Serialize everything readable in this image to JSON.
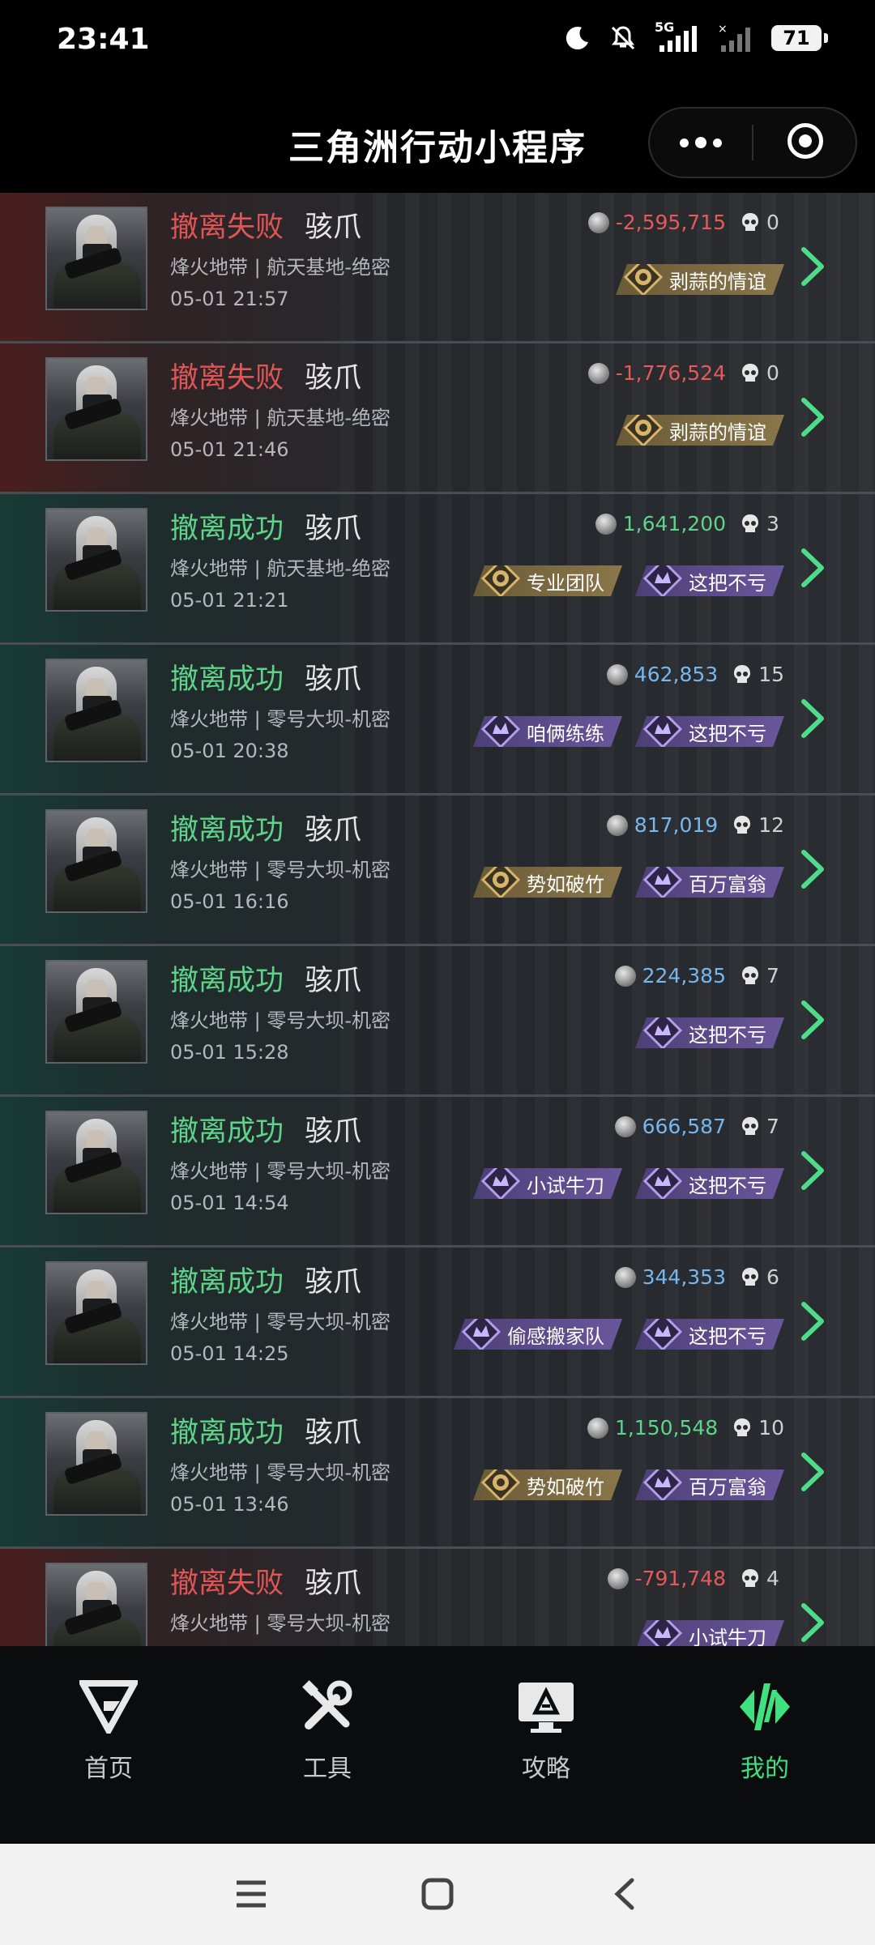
{
  "status_bar": {
    "time": "23:41",
    "network": "5G",
    "battery": "71"
  },
  "header": {
    "title": "三角洲行动小程序"
  },
  "records": [
    {
      "result": "撤离失败",
      "result_type": "fail",
      "operator": "骇爪",
      "map": "烽火地带 | 航天基地-绝密",
      "time": "05-01 21:57",
      "value": "-2,595,715",
      "value_type": "neg",
      "kills": "0",
      "badges": [
        {
          "label": "剥蒜的情谊",
          "style": "gold"
        }
      ]
    },
    {
      "result": "撤离失败",
      "result_type": "fail",
      "operator": "骇爪",
      "map": "烽火地带 | 航天基地-绝密",
      "time": "05-01 21:46",
      "value": "-1,776,524",
      "value_type": "neg",
      "kills": "0",
      "badges": [
        {
          "label": "剥蒜的情谊",
          "style": "gold"
        }
      ]
    },
    {
      "result": "撤离成功",
      "result_type": "success",
      "operator": "骇爪",
      "map": "烽火地带 | 航天基地-绝密",
      "time": "05-01 21:21",
      "value": "1,641,200",
      "value_type": "pos-green",
      "kills": "3",
      "badges": [
        {
          "label": "专业团队",
          "style": "gold"
        },
        {
          "label": "这把不亏",
          "style": "purple"
        }
      ]
    },
    {
      "result": "撤离成功",
      "result_type": "success",
      "operator": "骇爪",
      "map": "烽火地带 | 零号大坝-机密",
      "time": "05-01 20:38",
      "value": "462,853",
      "value_type": "pos",
      "kills": "15",
      "badges": [
        {
          "label": "咱俩练练",
          "style": "purple"
        },
        {
          "label": "这把不亏",
          "style": "purple"
        }
      ]
    },
    {
      "result": "撤离成功",
      "result_type": "success",
      "operator": "骇爪",
      "map": "烽火地带 | 零号大坝-机密",
      "time": "05-01 16:16",
      "value": "817,019",
      "value_type": "pos",
      "kills": "12",
      "badges": [
        {
          "label": "势如破竹",
          "style": "gold"
        },
        {
          "label": "百万富翁",
          "style": "purple"
        }
      ]
    },
    {
      "result": "撤离成功",
      "result_type": "success",
      "operator": "骇爪",
      "map": "烽火地带 | 零号大坝-机密",
      "time": "05-01 15:28",
      "value": "224,385",
      "value_type": "pos",
      "kills": "7",
      "badges": [
        {
          "label": "这把不亏",
          "style": "purple"
        }
      ]
    },
    {
      "result": "撤离成功",
      "result_type": "success",
      "operator": "骇爪",
      "map": "烽火地带 | 零号大坝-机密",
      "time": "05-01 14:54",
      "value": "666,587",
      "value_type": "pos",
      "kills": "7",
      "badges": [
        {
          "label": "小试牛刀",
          "style": "purple"
        },
        {
          "label": "这把不亏",
          "style": "purple"
        }
      ]
    },
    {
      "result": "撤离成功",
      "result_type": "success",
      "operator": "骇爪",
      "map": "烽火地带 | 零号大坝-机密",
      "time": "05-01 14:25",
      "value": "344,353",
      "value_type": "pos",
      "kills": "6",
      "badges": [
        {
          "label": "偷感搬家队",
          "style": "purple"
        },
        {
          "label": "这把不亏",
          "style": "purple"
        }
      ]
    },
    {
      "result": "撤离成功",
      "result_type": "success",
      "operator": "骇爪",
      "map": "烽火地带 | 零号大坝-机密",
      "time": "05-01 13:46",
      "value": "1,150,548",
      "value_type": "pos-green",
      "kills": "10",
      "badges": [
        {
          "label": "势如破竹",
          "style": "gold"
        },
        {
          "label": "百万富翁",
          "style": "purple"
        }
      ]
    },
    {
      "result": "撤离失败",
      "result_type": "fail",
      "operator": "骇爪",
      "map": "烽火地带 | 零号大坝-机密",
      "time": "",
      "value": "-791,748",
      "value_type": "neg",
      "kills": "4",
      "badges": [
        {
          "label": "小试牛刀",
          "style": "purple"
        }
      ]
    }
  ],
  "nav": [
    {
      "label": "首页",
      "icon": "home-logo-icon",
      "active": false
    },
    {
      "label": "工具",
      "icon": "tools-icon",
      "active": false
    },
    {
      "label": "攻略",
      "icon": "guide-monitor-icon",
      "active": false
    },
    {
      "label": "我的",
      "icon": "profile-logo-icon",
      "active": true
    }
  ],
  "colors": {
    "fail": "#e05656",
    "success": "#5fd38a",
    "value_pos": "#76b7ee",
    "value_neg": "#e75a5a",
    "nav_active": "#3ee07f"
  }
}
